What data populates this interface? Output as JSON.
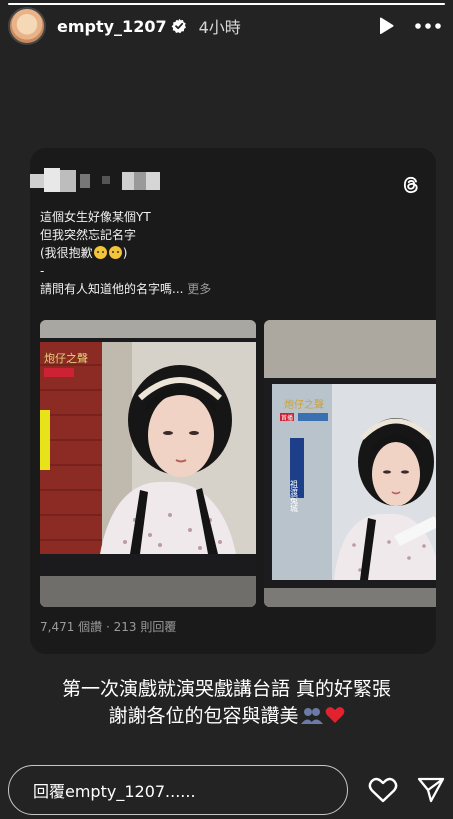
{
  "story": {
    "progress": 1.0,
    "username": "empty_1207",
    "time": "4小時",
    "verified": true
  },
  "post": {
    "lines": [
      "這個女生好像某個YT",
      "但我突然忘記名字",
      "(我很抱歉",
      ")",
      "-",
      "請問有人知道他的名字嗎..."
    ],
    "more_label": "更多",
    "stats": "7,471 個讚 · 213 則回覆",
    "tv_logo_text": "炮仔之聲",
    "tv_badge_text": "首播",
    "tv_caption_text": "祖渡冤城"
  },
  "caption": {
    "line1": "第一次演戲就演哭戲講台語 真的好緊張",
    "line2": "謝謝各位的包容與讚美"
  },
  "reply": {
    "placeholder": "回覆empty_1207......"
  },
  "icons": [
    "play-icon",
    "more-icon",
    "verified-icon",
    "threads-icon",
    "heart-icon",
    "send-icon"
  ],
  "colors": {
    "background": "#232323",
    "card": "#1a1a1a",
    "verified": "#ffffff"
  }
}
